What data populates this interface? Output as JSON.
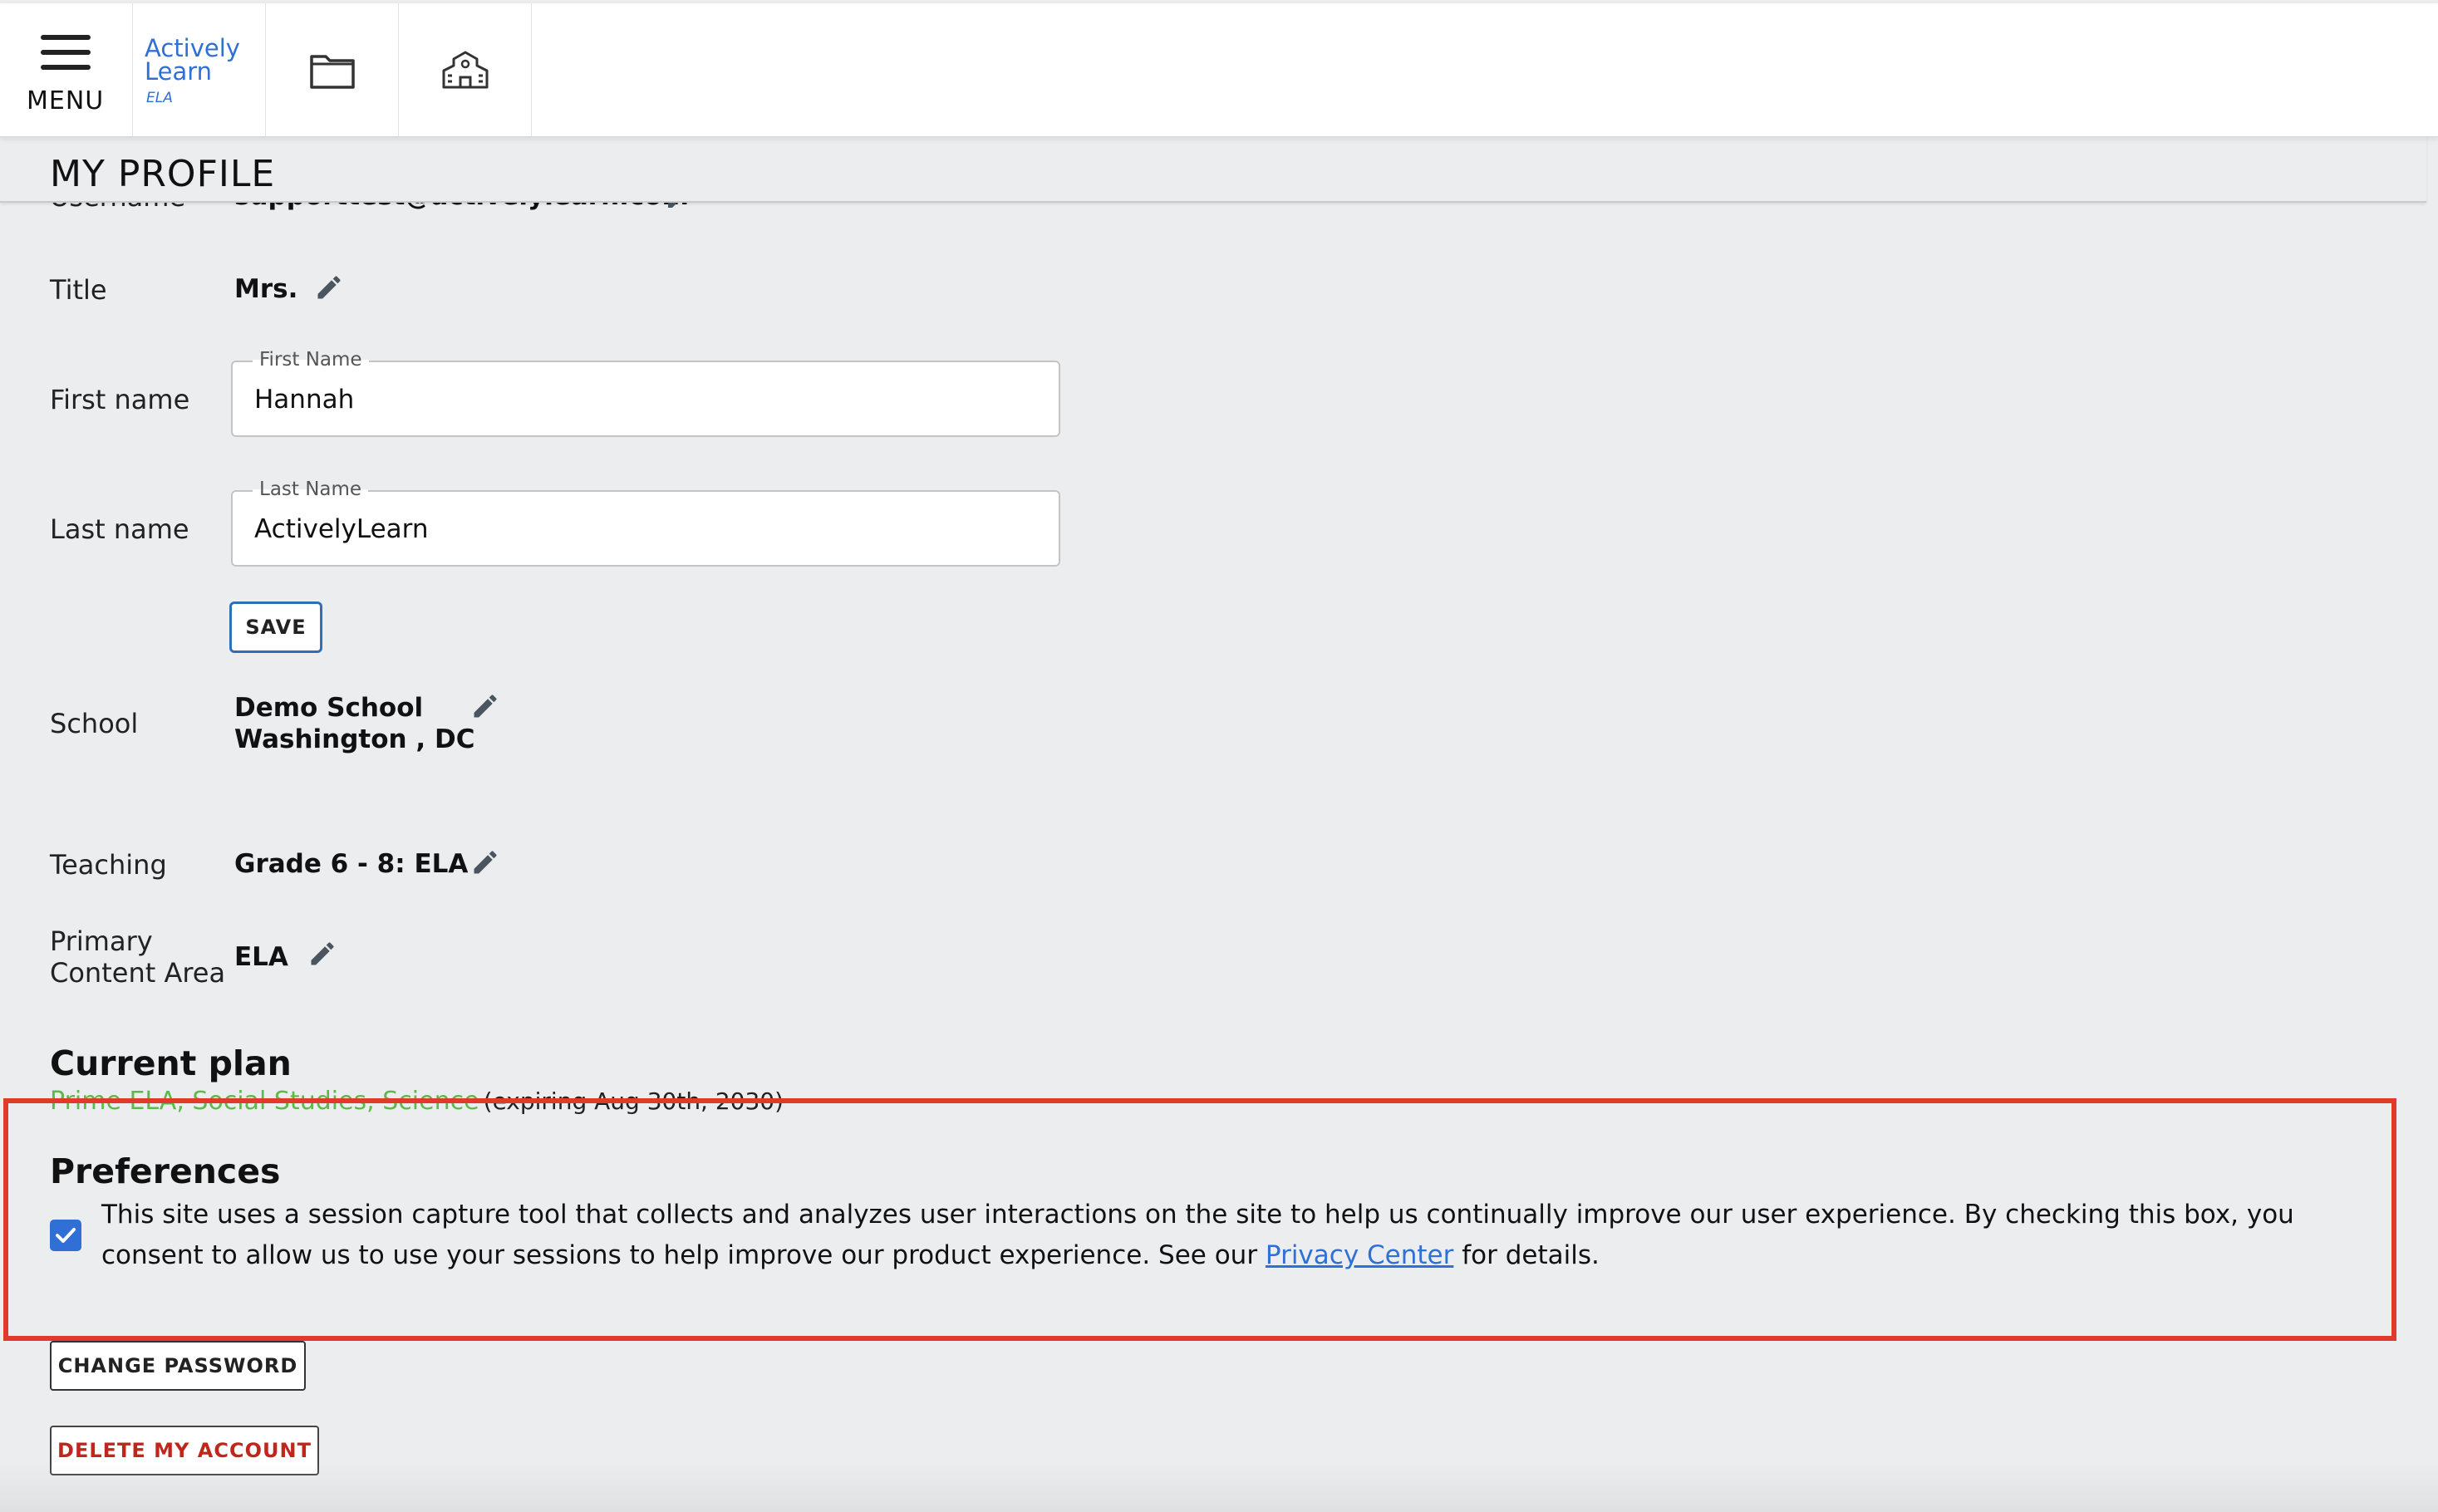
{
  "header": {
    "menu_label": "MENU",
    "logo": {
      "line1": "Actively",
      "line2": "Learn",
      "sub": "ELA"
    },
    "nav": [
      {
        "name": "library",
        "icon": "folder-icon"
      },
      {
        "name": "school",
        "icon": "school-building-icon"
      }
    ]
  },
  "page": {
    "title": "MY PROFILE"
  },
  "profile": {
    "username": {
      "label": "Username",
      "value": "supporttest@activelylearn.com"
    },
    "title": {
      "label": "Title",
      "value": "Mrs."
    },
    "first_name": {
      "label": "First name",
      "field_label": "First Name",
      "value": "Hannah"
    },
    "last_name": {
      "label": "Last name",
      "field_label": "Last Name",
      "value": "ActivelyLearn"
    },
    "save_label": "SAVE",
    "school": {
      "label": "School",
      "name": "Demo School",
      "location": "Washington , DC"
    },
    "teaching": {
      "label": "Teaching",
      "value": "Grade 6 - 8: ELA"
    },
    "primary_content_area": {
      "label_line1": "Primary",
      "label_line2": "Content Area",
      "value": "ELA"
    }
  },
  "plan": {
    "heading": "Current plan",
    "name": "Prime ELA, Social Studies, Science",
    "expiry": "(expiring Aug 30th, 2030)"
  },
  "preferences": {
    "heading": "Preferences",
    "checked": true,
    "text_before_link": "This site uses a session capture tool that collects and analyzes user interactions on the site to help us continually improve our user experience. By checking this box, you consent to allow us to use your sessions to help improve our product experience. See our ",
    "link_text": "Privacy Center",
    "text_after_link": " for details."
  },
  "actions": {
    "change_password": "CHANGE PASSWORD",
    "delete_account": "DELETE MY ACCOUNT"
  },
  "colors": {
    "accent": "#2f6fd6",
    "highlight_border": "#e03a2a",
    "plan_green": "#5cba4a",
    "delete_red": "#c0271c",
    "background": "#ecedef"
  }
}
